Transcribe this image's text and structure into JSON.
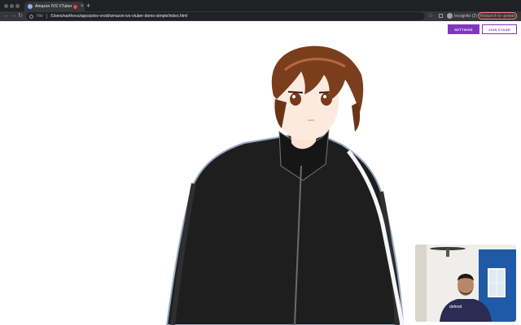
{
  "browser": {
    "tab_title": "Amazon IVS VTuber Demo",
    "new_tab": "+",
    "close": "×",
    "scheme_label": "File",
    "url": "/Users/earthovu/apps/pixiv-vroid/amazon-ivs-vtuber-demo-simple/index.html",
    "incognito_label": "Incognito (2)",
    "relaunch_label": "Relaunch to update",
    "nav_back": "←",
    "nav_forward": "→",
    "nav_reload": "↻",
    "star": "☆"
  },
  "page": {
    "settings_label": "SETTINGS",
    "join_stage_label": "JOIN STAGE",
    "accent_color": "#8236c0"
  },
  "webcam": {
    "shirt_text": "defend"
  }
}
